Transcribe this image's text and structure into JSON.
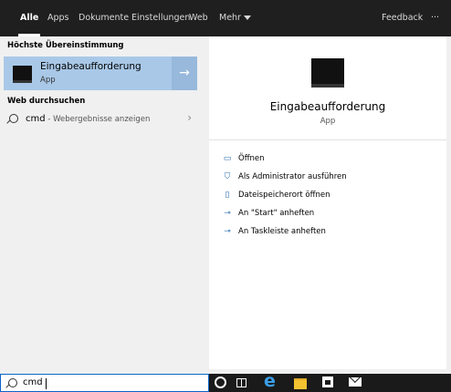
{
  "tabs": [
    {
      "label": "Alle",
      "active": true
    },
    {
      "label": "Apps"
    },
    {
      "label": "Dokumente"
    },
    {
      "label": "Einstellungen"
    },
    {
      "label": "Web"
    },
    {
      "label": "Mehr"
    }
  ],
  "header": {
    "feedback": "Feedback",
    "more_icon": "···"
  },
  "best_match": {
    "heading": "Höchste Übereinstimmung",
    "title": "Eingabeaufforderung",
    "subtitle": "App",
    "arrow": "→"
  },
  "web": {
    "heading": "Web durchsuchen",
    "query": "cmd",
    "suffix": " - Webergebnisse anzeigen",
    "chevron": "›"
  },
  "preview": {
    "title": "Eingabeaufforderung",
    "type": "App",
    "actions": [
      {
        "label": "Öffnen",
        "icon": "open-icon"
      },
      {
        "label": "Als Administrator ausführen",
        "icon": "run-as-admin-icon"
      },
      {
        "label": "Dateispeicherort öffnen",
        "icon": "file-location-icon"
      },
      {
        "label": "An \"Start\" anheften",
        "icon": "pin-icon"
      },
      {
        "label": "An Taskleiste anheften",
        "icon": "pin-icon"
      }
    ]
  },
  "search": {
    "value": "cmd"
  },
  "colors": {
    "accent": "#0a64c8",
    "selection": "#a9c8e8",
    "topbar": "#1f1f1f"
  }
}
